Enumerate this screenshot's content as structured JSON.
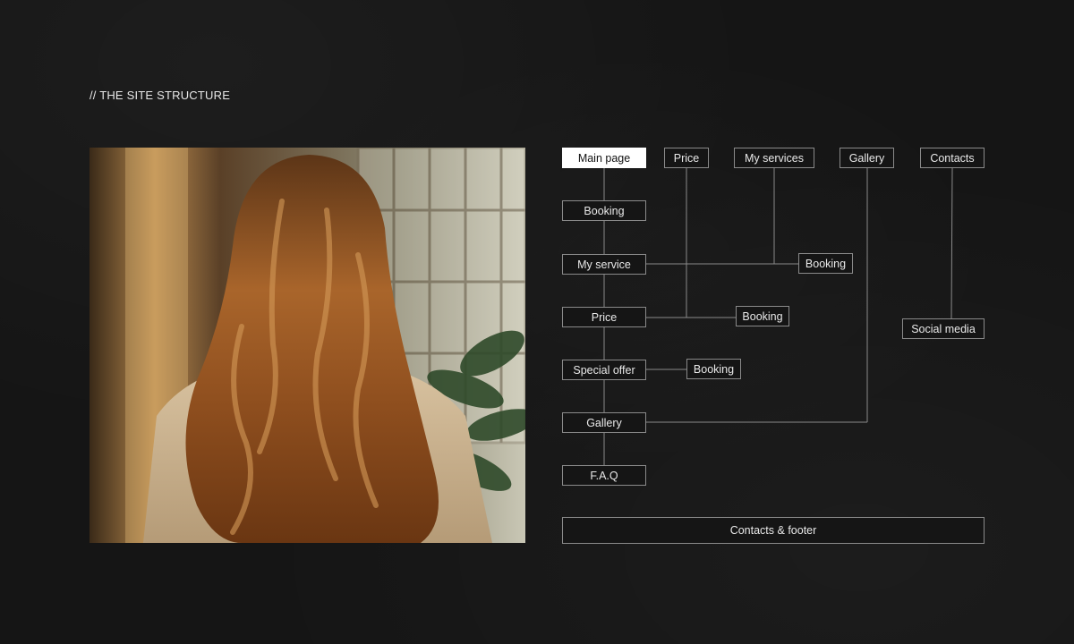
{
  "heading": "// THE SITE STRUCTURE",
  "top_nav": {
    "main_page": "Main page",
    "price": "Price",
    "my_services": "My services",
    "gallery": "Gallery",
    "contacts": "Contacts"
  },
  "main_page_sections": {
    "booking": "Booking",
    "my_service": "My service",
    "price": "Price",
    "special_offer": "Special offer",
    "gallery": "Gallery",
    "faq": "F.A.Q"
  },
  "booking_nodes": {
    "my_service_booking": "Booking",
    "price_booking": "Booking",
    "special_offer_booking": "Booking"
  },
  "contacts_children": {
    "social_media": "Social media"
  },
  "footer": "Contacts & footer",
  "colors": {
    "background": "#151515",
    "line": "#8a8a8a",
    "active_fill": "#ffffff"
  }
}
